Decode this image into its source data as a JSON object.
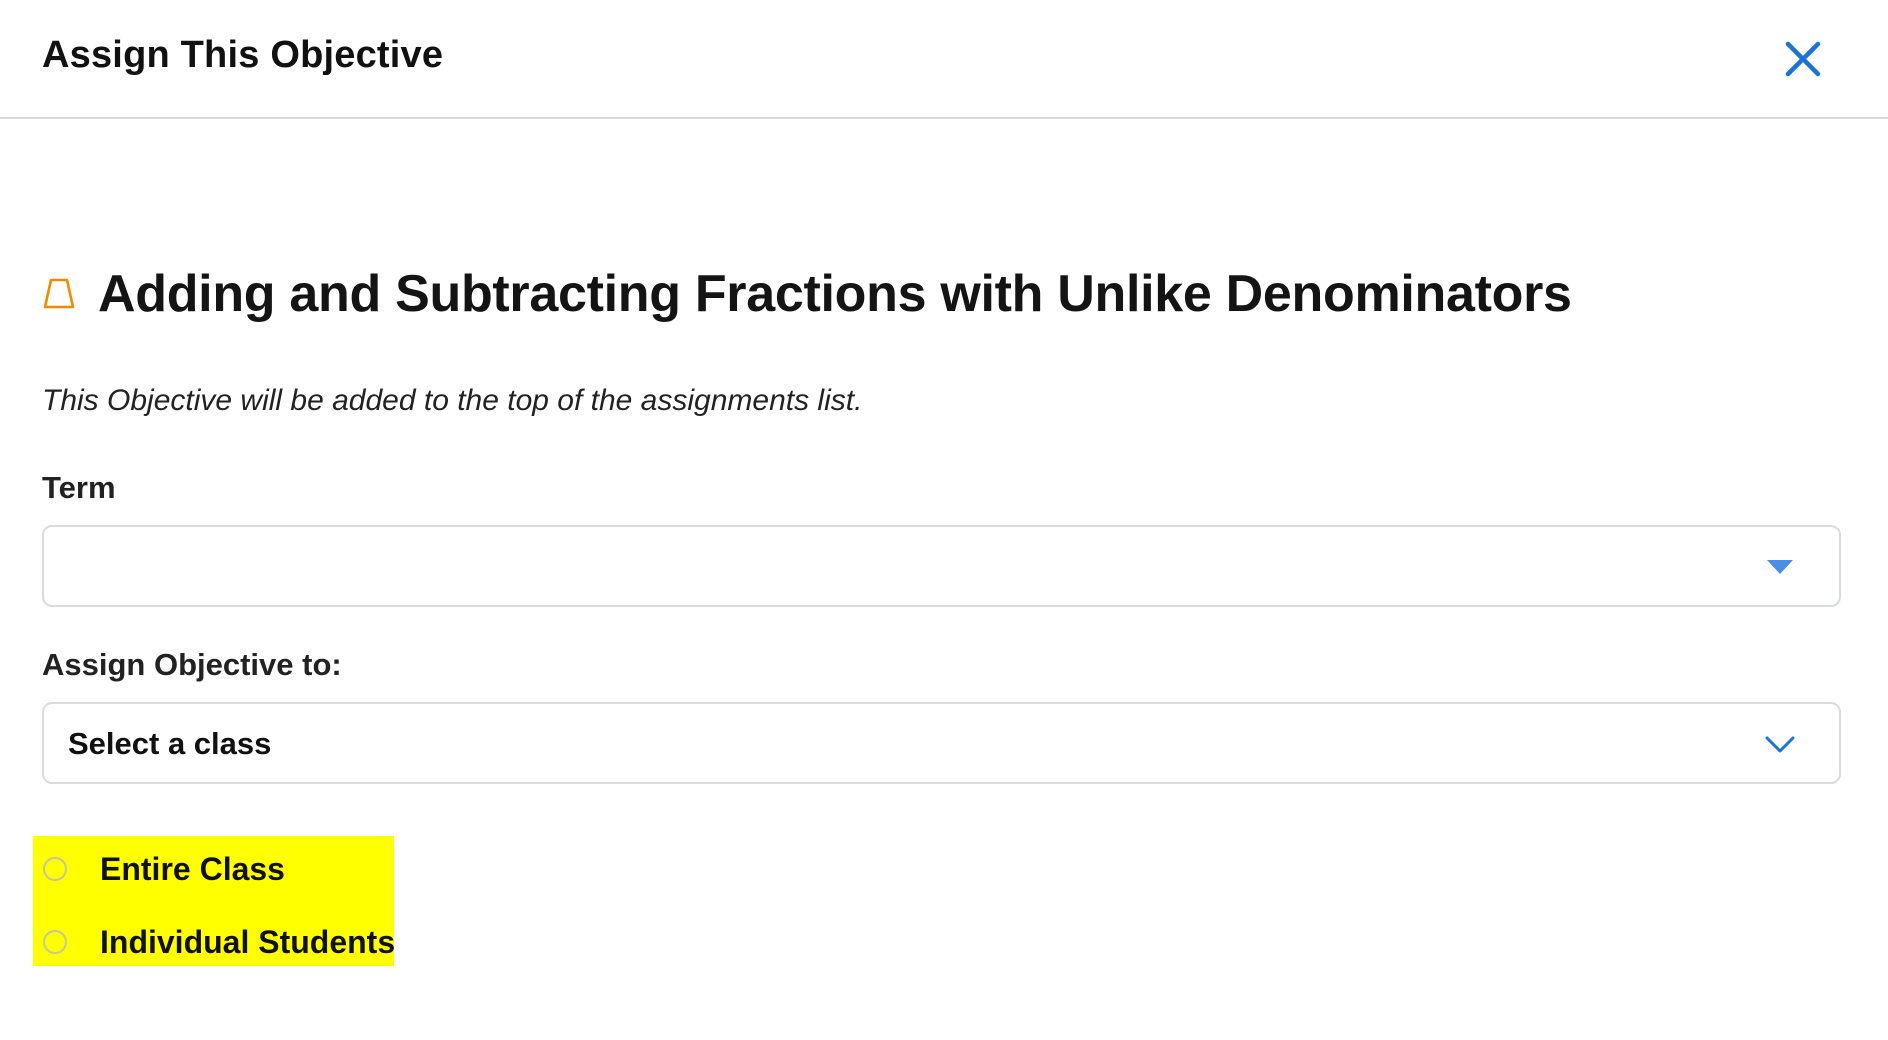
{
  "modal": {
    "title": "Assign This Objective",
    "close_icon": "close-icon",
    "accent_color": "#1a73d9"
  },
  "objective": {
    "icon": "trapezoid-outline-icon",
    "icon_color": "#f08a00",
    "title": "Adding and Subtracting Fractions with Unlike Denominators",
    "description": "This Objective will be added to the top of the assignments list."
  },
  "form": {
    "term": {
      "label": "Term",
      "value": "",
      "icon": "caret-down-icon"
    },
    "assign_to": {
      "label": "Assign Objective to:",
      "value": "Select a class",
      "icon": "chevron-down-icon"
    },
    "assign_mode": {
      "highlight_color": "#ffff00",
      "options": [
        {
          "label": "Entire Class",
          "selected": false
        },
        {
          "label": "Individual Students",
          "selected": false
        }
      ]
    }
  }
}
